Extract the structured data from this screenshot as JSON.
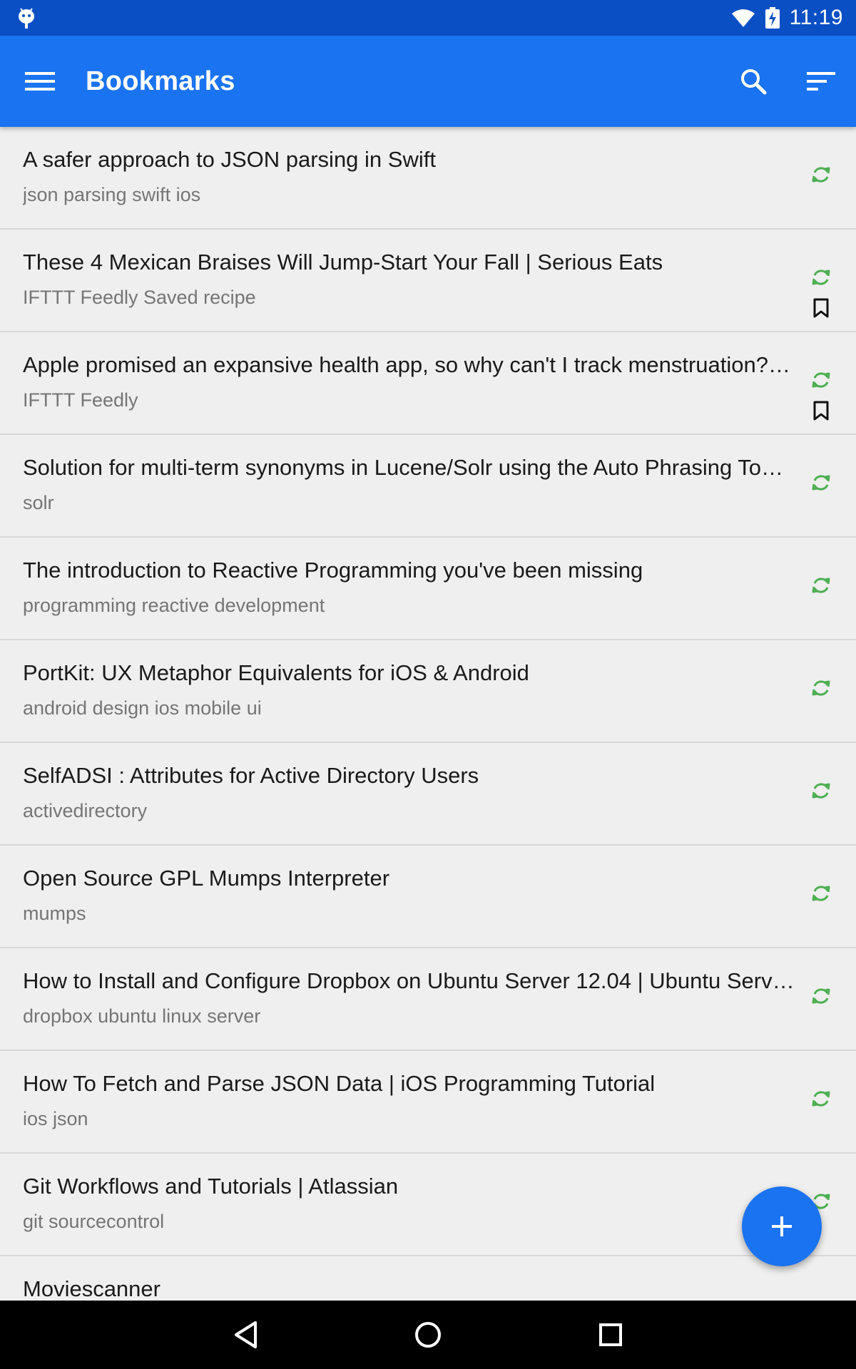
{
  "status_bar": {
    "time": "11:19",
    "icons": [
      "android-notification-icon",
      "wifi-icon",
      "battery-charging-icon"
    ]
  },
  "app_bar": {
    "title": "Bookmarks",
    "icons": [
      "menu-icon",
      "search-icon",
      "sort-icon"
    ],
    "color": "#1a73f0"
  },
  "colors": {
    "status_bar": "#0a4fc4",
    "sync_icon": "#4caf50",
    "background": "#efefef"
  },
  "bookmarks": [
    {
      "title": "A safer approach to JSON parsing in Swift",
      "tags": "json parsing swift ios",
      "synced": true,
      "bookmarked": false
    },
    {
      "title": "These 4 Mexican Braises Will Jump-Start Your Fall | Serious Eats",
      "tags": "IFTTT Feedly Saved recipe",
      "synced": true,
      "bookmarked": true
    },
    {
      "title": "Apple promised an expansive health app, so why can't I track menstruation?…",
      "tags": "IFTTT Feedly",
      "synced": true,
      "bookmarked": true
    },
    {
      "title": "Solution for multi-term synonyms in Lucene/Solr using the Auto Phrasing To…",
      "tags": "solr",
      "synced": true,
      "bookmarked": false
    },
    {
      "title": "The introduction to Reactive Programming you've been missing",
      "tags": "programming reactive development",
      "synced": true,
      "bookmarked": false
    },
    {
      "title": "PortKit: UX Metaphor Equivalents for iOS & Android",
      "tags": "android design ios mobile ui",
      "synced": true,
      "bookmarked": false
    },
    {
      "title": "SelfADSI : Attributes for Active Directory Users",
      "tags": "activedirectory",
      "synced": true,
      "bookmarked": false
    },
    {
      "title": "Open Source GPL Mumps Interpreter",
      "tags": "mumps",
      "synced": true,
      "bookmarked": false
    },
    {
      "title": "How to Install and Configure Dropbox on Ubuntu Server 12.04 | Ubuntu Serv…",
      "tags": "dropbox ubuntu linux server",
      "synced": true,
      "bookmarked": false
    },
    {
      "title": "How To Fetch and Parse JSON Data | iOS Programming Tutorial",
      "tags": "ios json",
      "synced": true,
      "bookmarked": false
    },
    {
      "title": "Git Workflows and Tutorials | Atlassian",
      "tags": "git sourcecontrol",
      "synced": true,
      "bookmarked": false
    },
    {
      "title": "Moviescanner",
      "tags": "",
      "synced": false,
      "bookmarked": false
    }
  ],
  "fab": {
    "icon": "plus-icon"
  },
  "nav_bar": {
    "icons": [
      "back-icon",
      "home-icon",
      "recents-icon"
    ]
  }
}
